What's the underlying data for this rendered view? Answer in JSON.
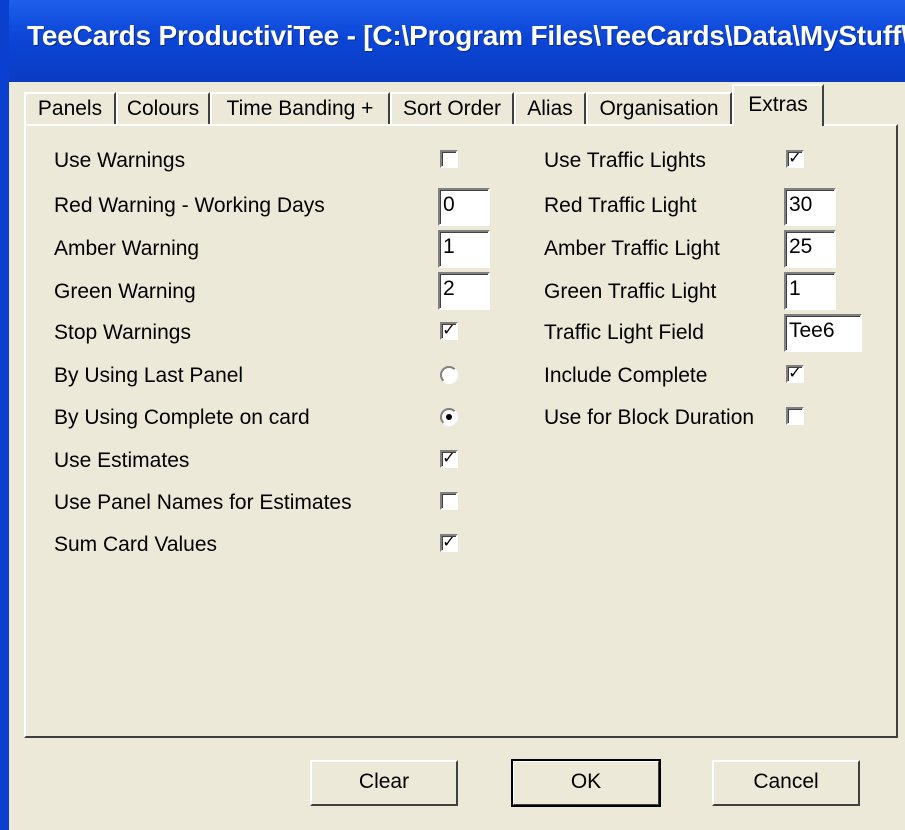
{
  "window": {
    "title": "TeeCards ProductiviTee - [C:\\Program Files\\TeeCards\\Data\\MyStuff\\P..."
  },
  "tabs": [
    {
      "label": "Panels"
    },
    {
      "label": "Colours"
    },
    {
      "label": "Time Banding +"
    },
    {
      "label": "Sort Order"
    },
    {
      "label": "Alias"
    },
    {
      "label": "Organisation"
    },
    {
      "label": "Extras",
      "active": true
    }
  ],
  "left": {
    "use_warnings": {
      "label": "Use Warnings",
      "checked": false
    },
    "red_warning": {
      "label": "Red Warning - Working Days",
      "value": "0"
    },
    "amber_warning": {
      "label": "Amber Warning",
      "value": "1"
    },
    "green_warning": {
      "label": "Green Warning",
      "value": "2"
    },
    "stop_warnings": {
      "label": "Stop Warnings",
      "checked": true,
      "mark": "✓"
    },
    "by_last_panel": {
      "label": "By Using Last Panel",
      "selected": false
    },
    "by_complete": {
      "label": "By Using Complete on card",
      "selected": true
    },
    "use_estimates": {
      "label": "Use Estimates",
      "checked": true,
      "mark": "✓"
    },
    "panel_names_estimates": {
      "label": "Use Panel Names for Estimates",
      "checked": false
    },
    "sum_card_values": {
      "label": "Sum Card Values",
      "checked": true,
      "mark": "✓"
    }
  },
  "right": {
    "use_traffic_lights": {
      "label": "Use Traffic Lights",
      "checked": true,
      "mark": "✓"
    },
    "red_traffic_light": {
      "label": "Red Traffic Light",
      "value": "30"
    },
    "amber_traffic_light": {
      "label": "Amber Traffic Light",
      "value": "25"
    },
    "green_traffic_light": {
      "label": "Green Traffic Light",
      "value": "1"
    },
    "traffic_light_field": {
      "label": "Traffic Light Field",
      "value": "Tee6"
    },
    "include_complete": {
      "label": "Include Complete",
      "checked": true,
      "mark": "✓"
    },
    "block_duration": {
      "label": "Use for Block Duration",
      "checked": false
    }
  },
  "buttons": {
    "clear": "Clear",
    "ok": "OK",
    "cancel": "Cancel"
  },
  "colors": {
    "titlebar": "#0b46d8",
    "face": "#ece9d8"
  }
}
